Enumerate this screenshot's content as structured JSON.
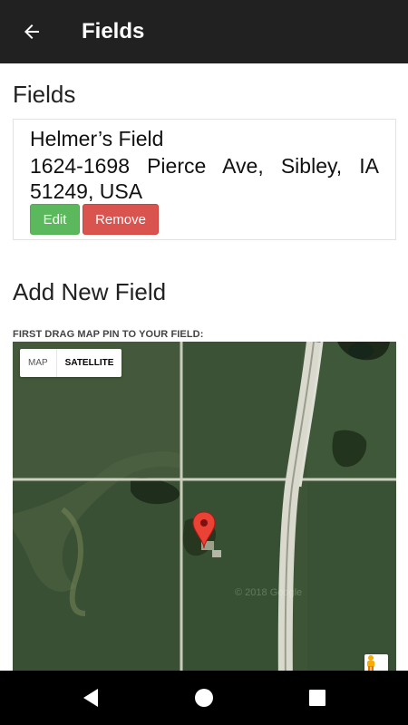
{
  "appbar": {
    "title": "Fields",
    "back_icon": "arrow-left-icon"
  },
  "fields_section": {
    "heading": "Fields",
    "items": [
      {
        "name": "Helmer’s Field",
        "address": "1624-1698 Pierce Ave, Sibley, IA 51249, USA",
        "edit_label": "Edit",
        "remove_label": "Remove"
      }
    ]
  },
  "add_section": {
    "heading": "Add New Field",
    "instruction": "FIRST DRAG MAP PIN TO YOUR FIELD:",
    "map": {
      "type_map_label": "MAP",
      "type_satellite_label": "SATELLITE",
      "selected_type": "SATELLITE",
      "watermark": "© 2018 Google",
      "pin_icon": "map-pin-icon",
      "pegman_icon": "pegman-icon"
    }
  },
  "colors": {
    "appbar": "#212121",
    "edit_button": "#5cb85c",
    "remove_button": "#d9534f",
    "pin": "#ea4335"
  },
  "system_nav": {
    "back_icon": "nav-back-icon",
    "home_icon": "nav-home-icon",
    "recents_icon": "nav-recents-icon"
  }
}
